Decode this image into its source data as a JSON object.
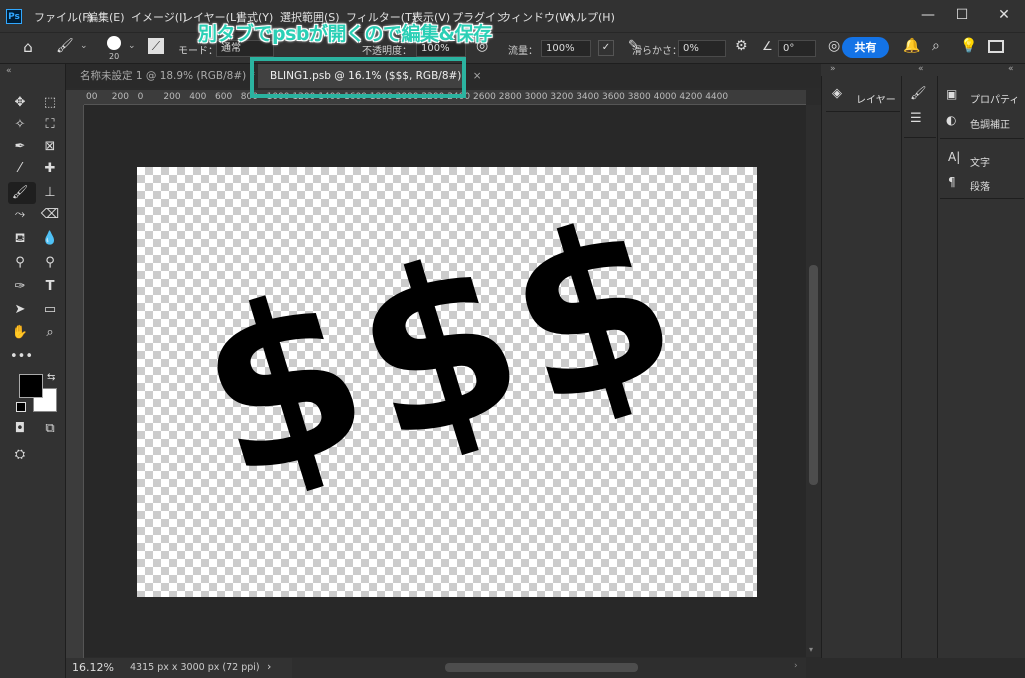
{
  "app": {
    "logo": "Ps"
  },
  "menu": [
    "ファイル(F)",
    "編集(E)",
    "イメージ(I)",
    "レイヤー(L)",
    "書式(Y)",
    "選択範囲(S)",
    "フィルター(T)",
    "表示(V)",
    "プラグイン",
    "ウィンドウ(W)",
    "ヘルプ(H)"
  ],
  "window_controls": {
    "minimize": "—",
    "maximize": "☐",
    "close": "✕"
  },
  "options": {
    "brush_size": "20",
    "mode_label": "モード：",
    "mode_value": "通常",
    "opacity_label": "不透明度：",
    "opacity_value": "100%",
    "flow_label": "流量：",
    "flow_value": "100%",
    "smoothing_label": "滑らかさ：",
    "smoothing_value": "0%",
    "angle_value": "0°",
    "share_label": "共有"
  },
  "annotation": {
    "text": "別タブでpsbが開くので編集&保存"
  },
  "tabs": [
    {
      "label": "名称未設定 1 @ 18.9% (RGB/8#) *",
      "close": "×"
    },
    {
      "label": "BLING1.psb @ 16.1% ($$$, RGB/8#)",
      "close": "×"
    }
  ],
  "ruler_labels": [
    "00",
    "200",
    "0",
    "200",
    "400",
    "600",
    "800",
    "1000",
    "1200",
    "1400",
    "1600",
    "1800",
    "2000",
    "2200",
    "2400",
    "2600",
    "2800",
    "3000",
    "3200",
    "3400",
    "3600",
    "3800",
    "4000",
    "4200",
    "4400"
  ],
  "canvas": {
    "text": "$$$"
  },
  "status": {
    "zoom": "16.12%",
    "doc_info": "4315 px x 3000 px (72 ppi)",
    "arrow": "›"
  },
  "panels": {
    "layers_label": "レイヤー",
    "properties_label": "プロパティ",
    "adjustments_label": "色調補正",
    "character_label": "文字",
    "paragraph_label": "段落"
  },
  "colors": {
    "accent_annotation": "#2bb3a0",
    "share_button": "#1473e6"
  }
}
